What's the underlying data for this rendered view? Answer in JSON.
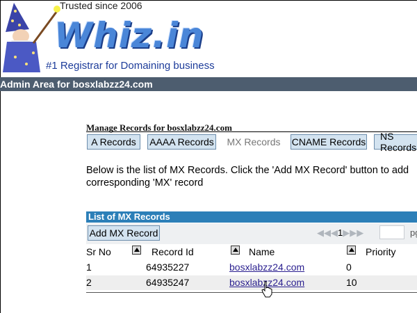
{
  "header": {
    "tagline_top": "Trusted since 2006",
    "logo_text": "Whiz.in",
    "tagline": "#1 Registrar for Domaining business"
  },
  "admin_bar": {
    "title": "Admin Area for bosxlabzz24.com"
  },
  "manage": {
    "title": "Manage Records for bosxlabzz24.com",
    "tabs": [
      {
        "label": "A Records",
        "active": true
      },
      {
        "label": "AAAA Records",
        "active": true
      },
      {
        "label": "MX Records",
        "active": false
      },
      {
        "label": "CNAME Records",
        "active": true
      },
      {
        "label": "NS Records",
        "active": true
      }
    ]
  },
  "description": {
    "line1": "Below is the list of MX Records. Click the 'Add MX Record' button to add",
    "line2": "corresponding 'MX' record"
  },
  "panel": {
    "title": "List of MX Records",
    "add_button": "Add MX Record",
    "pager": {
      "current_page": "1",
      "page_label": "pg"
    },
    "columns": [
      "Sr No",
      "Record Id",
      "Name",
      "Priority"
    ],
    "rows": [
      {
        "sr_no": "1",
        "record_id": "64935227",
        "name": "bosxlabzz24.com",
        "priority": "0"
      },
      {
        "sr_no": "2",
        "record_id": "64935247",
        "name": "bosxlabzz24.com",
        "priority": "10"
      }
    ]
  },
  "colors": {
    "admin_bar": "#4d5d6f",
    "panel_header": "#2c7fb8",
    "tab_bg": "#d3e3f0",
    "link": "#2a1f8f"
  }
}
